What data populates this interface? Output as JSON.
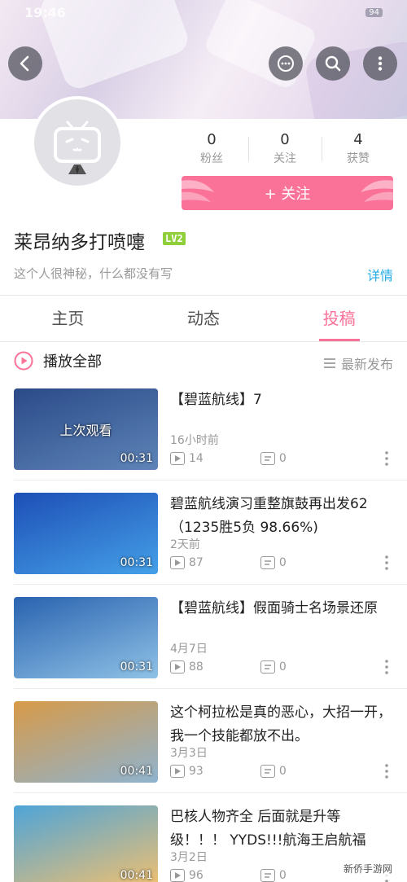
{
  "status": {
    "time": "19:46",
    "battery": "94"
  },
  "header": {
    "back_icon": "chevron-left-icon",
    "chat_icon": "chat-bubble-icon",
    "search_icon": "search-icon",
    "more_icon": "more-vertical-icon"
  },
  "profile": {
    "stats": [
      {
        "value": "0",
        "label": "粉丝"
      },
      {
        "value": "0",
        "label": "关注"
      },
      {
        "value": "4",
        "label": "获赞"
      }
    ],
    "follow_label": "+ 关注",
    "username": "莱昂纳多打喷嚏",
    "level": "LV2",
    "bio": "这个人很神秘，什么都没有写",
    "detail_link": "详情"
  },
  "tabs": [
    {
      "label": "主页",
      "active": false
    },
    {
      "label": "动态",
      "active": false
    },
    {
      "label": "投稿",
      "active": true
    }
  ],
  "list_header": {
    "play_all": "播放全部",
    "sort_label": "最新发布"
  },
  "videos": [
    {
      "title": "【碧蓝航线】7",
      "time": "16小时前",
      "views": "14",
      "comments": "0",
      "duration": "00:31",
      "overlay": "上次观看",
      "colors": [
        "#2a4a88",
        "#5e84b8"
      ]
    },
    {
      "title": "碧蓝航线演习重整旗鼓再出发62（1235胜5负 98.66%)",
      "time": "2天前",
      "views": "87",
      "comments": "0",
      "duration": "00:31",
      "colors": [
        "#1d4fb6",
        "#45a0e8"
      ]
    },
    {
      "title": "【碧蓝航线】假面骑士名场景还原",
      "time": "4月7日",
      "views": "88",
      "comments": "0",
      "duration": "00:31",
      "colors": [
        "#2a63b0",
        "#8fc2e6"
      ]
    },
    {
      "title": "这个柯拉松是真的恶心，大招一开，我一个技能都放不出。",
      "time": "3月3日",
      "views": "93",
      "comments": "0",
      "duration": "00:41",
      "colors": [
        "#d79a48",
        "#8fb3cf"
      ]
    },
    {
      "title": "巴核人物齐全 后面就是升等级！！！ YYDS!!!航海王启航福",
      "time": "3月2日",
      "views": "96",
      "comments": "0",
      "duration": "00:41",
      "colors": [
        "#4ea4d8",
        "#f0c070"
      ]
    }
  ],
  "watermark": "新侨手游网"
}
